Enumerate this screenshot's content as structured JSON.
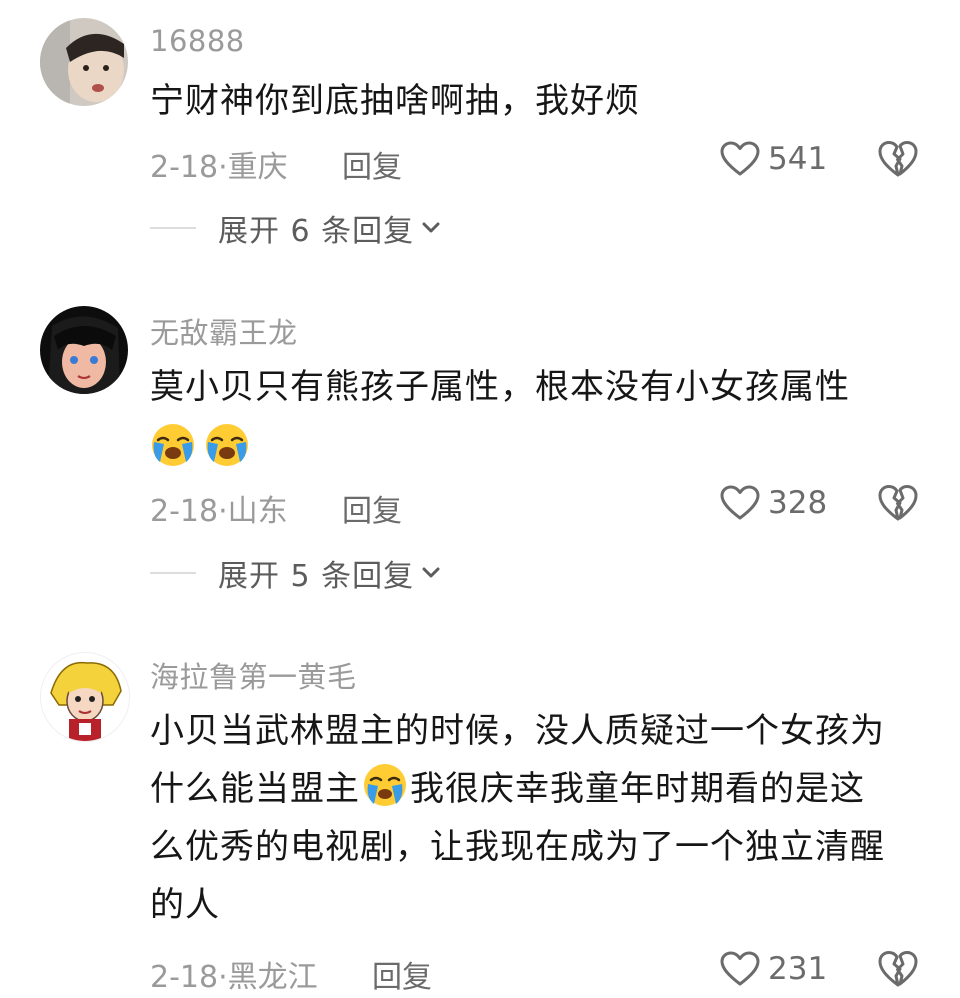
{
  "comments": [
    {
      "username": "16888",
      "lines": [
        "宁财神你到底抽啥啊抽，我好烦"
      ],
      "emoji_count": 0,
      "date": "2-18",
      "location": "重庆",
      "reply_label": "回复",
      "likes": "541",
      "expand_label": "展开 6 条回复"
    },
    {
      "username": "无敌霸王龙",
      "lines": [
        "莫小贝只有熊孩子属性，根本没有小女孩属性"
      ],
      "emoji_count": 2,
      "emoji_name": "loudly-crying-face",
      "date": "2-18",
      "location": "山东",
      "reply_label": "回复",
      "likes": "328",
      "expand_label": "展开 5 条回复"
    },
    {
      "username": "海拉鲁第一黄毛",
      "lines": [
        "小贝当武林盟主的时候，没人质疑过一个女孩为",
        "什么能当盟主",
        "我很庆幸我童年时期看的是这",
        "么优秀的电视剧，让我现在成为了一个独立清醒",
        "的人"
      ],
      "inline_emoji_name": "crying-face",
      "date": "2-18",
      "location": "黑龙江",
      "reply_label": "回复",
      "likes": "231"
    }
  ],
  "icons": {
    "like": "heart-outline-icon",
    "dislike": "broken-heart-icon",
    "expand": "chevron-down-icon"
  },
  "colors": {
    "text": "#161616",
    "meta": "#9a9a9a",
    "action": "#6b6b6b",
    "emoji_face": "#ffcc33",
    "emoji_tear": "#3a9be8"
  }
}
